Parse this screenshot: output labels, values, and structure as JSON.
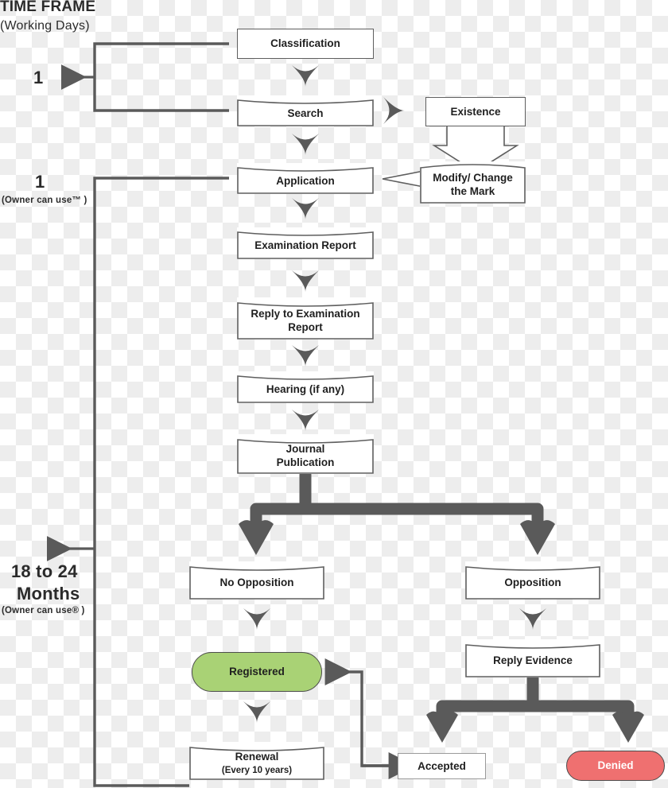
{
  "header": {
    "title": "TIME FRAME",
    "subtitle": "(Working Days)"
  },
  "timeline_labels": [
    {
      "value": "1",
      "note": ""
    },
    {
      "value": "1",
      "note": "(Owner can use™ )"
    },
    {
      "value": "18 to 24",
      "value2": "Months",
      "note": "(Owner can use® )"
    }
  ],
  "nodes": {
    "classification": "Classification",
    "search": "Search",
    "existence": "Existence",
    "modify_line1": "Modify/ Change",
    "modify_line2": "the Mark",
    "application": "Application",
    "examination_report": "Examination Report",
    "reply_examination_line1": "Reply to Examination",
    "reply_examination_line2": "Report",
    "hearing": "Hearing (if any)",
    "journal_line1": "Journal",
    "journal_line2": "Publication",
    "no_opposition": "No Opposition",
    "opposition": "Opposition",
    "registered": "Registered",
    "reply_evidence": "Reply Evidence",
    "renewal_line1": "Renewal",
    "renewal_line2": "(Every 10 years)",
    "accepted": "Accepted",
    "denied": "Denied"
  },
  "colors": {
    "registered_fill": "#a9d275",
    "denied_fill": "#ef7070",
    "connector": "#5a5a5a",
    "border": "#5e5e5e",
    "text": "#1f1f1f"
  }
}
